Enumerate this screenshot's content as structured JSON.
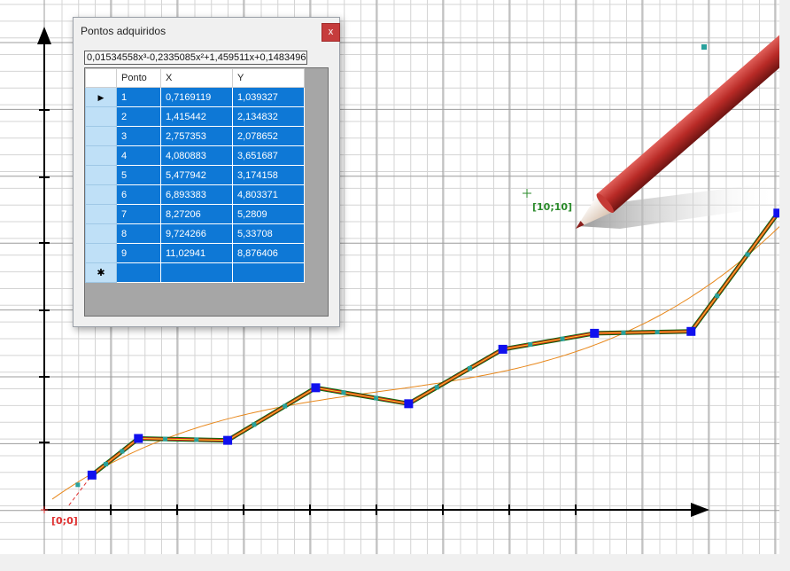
{
  "canvas": {
    "origin_label": "[0;0]",
    "reference_label": "[10;10]"
  },
  "dialog": {
    "title": "Pontos adquiridos",
    "close_glyph": "x",
    "formula": "0,01534558x³-0,2335085x²+1,459511x+0,1483496",
    "columns": [
      "Ponto",
      "X",
      "Y"
    ],
    "current_row_marker": "▶",
    "new_row_marker": "✱",
    "rows": [
      [
        "1",
        "0,7169119",
        "1,039327"
      ],
      [
        "2",
        "1,415442",
        "2,134832"
      ],
      [
        "3",
        "2,757353",
        "2,078652"
      ],
      [
        "4",
        "4,080883",
        "3,651687"
      ],
      [
        "5",
        "5,477942",
        "3,174158"
      ],
      [
        "6",
        "6,893383",
        "4,803371"
      ],
      [
        "7",
        "8,27206",
        "5,2809"
      ],
      [
        "8",
        "9,724266",
        "5,33708"
      ],
      [
        "9",
        "11,02941",
        "8,876406"
      ]
    ]
  },
  "colors": {
    "polyline_outer": "#0a6a0a",
    "polyline_mid": "#d42020",
    "polyline_inner": "#f0e020",
    "fit_curve": "#e8881c",
    "point_marker": "#1010ee",
    "raw_sample": "#2aa19c",
    "pencil_body": "#c0302c",
    "selection": "#0e78d6"
  },
  "icons": [
    "pencil-cursor-icon",
    "close-icon",
    "row-pointer-icon",
    "new-row-icon"
  ]
}
